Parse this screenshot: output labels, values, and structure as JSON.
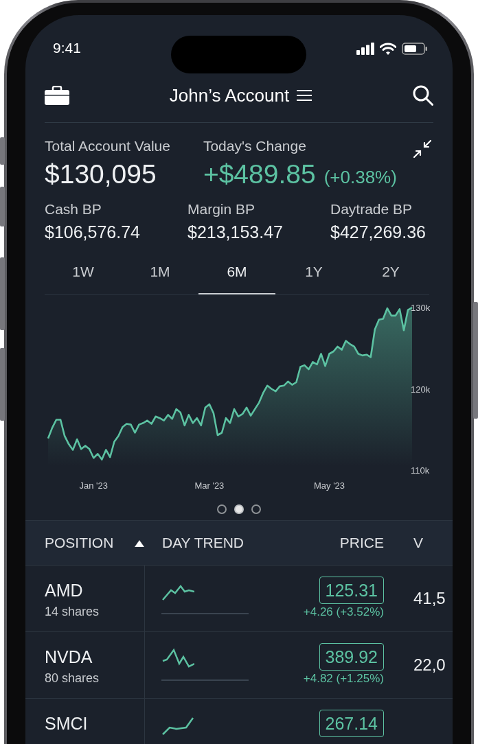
{
  "status_bar": {
    "time": "9:41"
  },
  "header": {
    "title": "John’s Account"
  },
  "summary": {
    "total_label": "Total Account Value",
    "total_value": "$130,095",
    "change_label": "Today's Change",
    "change_value": "+$489.85",
    "change_percent": "(+0.38%)"
  },
  "buying_power": [
    {
      "label": "Cash BP",
      "value": "$106,576.74"
    },
    {
      "label": "Margin BP",
      "value": "$213,153.47"
    },
    {
      "label": "Daytrade BP",
      "value": "$427,269.36"
    }
  ],
  "range_tabs": [
    {
      "label": "1W",
      "selected": false
    },
    {
      "label": "1M",
      "selected": false
    },
    {
      "label": "6M",
      "selected": true
    },
    {
      "label": "1Y",
      "selected": false
    },
    {
      "label": "2Y",
      "selected": false
    }
  ],
  "chart": {
    "chart_data": {
      "type": "area",
      "ylim": [
        110,
        130
      ],
      "categories": [
        null,
        null,
        null,
        null,
        null,
        null,
        null,
        null,
        null,
        null,
        null,
        "Jan '23",
        null,
        null,
        null,
        null,
        null,
        null,
        null,
        null,
        null,
        null,
        null,
        null,
        null,
        null,
        null,
        null,
        null,
        null,
        null,
        null,
        null,
        null,
        null,
        null,
        null,
        null,
        null,
        "Mar '23",
        null,
        null,
        null,
        null,
        null,
        null,
        null,
        null,
        null,
        null,
        null,
        null,
        null,
        null,
        null,
        null,
        null,
        null,
        null,
        null,
        null,
        null,
        null,
        null,
        null,
        null,
        null,
        null,
        "May '23",
        null,
        null,
        null,
        null,
        null,
        null,
        null,
        null,
        null,
        null,
        null,
        null,
        null,
        null,
        null,
        null,
        null,
        null,
        null,
        null
      ],
      "yticks": [
        {
          "value": 110,
          "label": "110k"
        },
        {
          "value": 120,
          "label": "120k"
        },
        {
          "value": 130,
          "label": "130k"
        }
      ],
      "series": [
        {
          "color": "#5cc2a2",
          "values": [
            113.9,
            115.2,
            116.2,
            116.2,
            114.2,
            113.2,
            112.5,
            113.8,
            112.6,
            113.0,
            112.6,
            111.5,
            112.0,
            111.3,
            112.5,
            111.6,
            113.5,
            114.2,
            115.3,
            115.7,
            115.6,
            114.6,
            115.6,
            115.8,
            116.1,
            115.7,
            116.6,
            116.4,
            116.1,
            116.8,
            116.3,
            117.5,
            117.1,
            115.5,
            116.8,
            115.8,
            116.4,
            115.5,
            117.7,
            118.1,
            117.0,
            114.3,
            114.6,
            116.4,
            115.8,
            117.5,
            116.6,
            116.9,
            117.7,
            116.7,
            117.5,
            118.3,
            119.5,
            120.4,
            120.0,
            119.7,
            120.3,
            120.4,
            120.9,
            120.5,
            120.8,
            122.7,
            122.9,
            122.4,
            123.3,
            123.0,
            124.3,
            122.8,
            124.3,
            124.6,
            125.2,
            124.8,
            125.9,
            125.5,
            125.2,
            124.3,
            124.1,
            124.2,
            123.9,
            127.3,
            128.5,
            128.6,
            129.9,
            129.0,
            129.0,
            129.8,
            127.2,
            129.7,
            130.0
          ]
        }
      ]
    }
  },
  "pager": [
    {
      "selected": false
    },
    {
      "selected": true
    },
    {
      "selected": false
    }
  ],
  "positions": {
    "columns": [
      {
        "label": "POSITION",
        "sorted": true
      },
      {
        "label": "DAY TREND",
        "sorted": false
      },
      {
        "label": "PRICE",
        "sorted": false
      },
      {
        "label": "V",
        "sorted": false
      }
    ],
    "rows": [
      {
        "symbol": "AMD",
        "shares": "14 shares",
        "price": "125.31",
        "change": "+4.26 (+3.52%)",
        "volume": "41,5"
      },
      {
        "symbol": "NVDA",
        "shares": "80 shares",
        "price": "389.92",
        "change": "+4.82 (+1.25%)",
        "volume": "22,0"
      },
      {
        "symbol": "SMCI",
        "price": "267.14"
      }
    ]
  }
}
